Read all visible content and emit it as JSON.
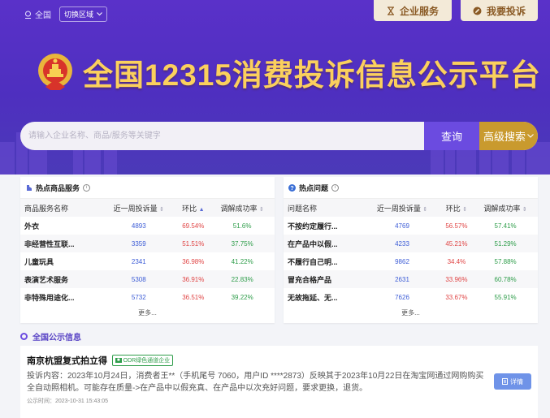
{
  "topbar": {
    "location": "全国",
    "switch_region": "切换区域",
    "enterprise_service": "企业服务",
    "complain": "我要投诉"
  },
  "site_title": "全国12315消费投诉信息公示平台",
  "search": {
    "placeholder": "请输入企业名称、商品/服务等关键字",
    "query_label": "查询",
    "advanced_label": "高级搜索"
  },
  "hot_products": {
    "title": "热点商品服务",
    "columns": [
      "商品服务名称",
      "近一周投诉量",
      "环比",
      "调解成功率"
    ],
    "rows": [
      {
        "name": "外衣",
        "count": "4893",
        "ratio": "69.54%",
        "rate": "51.6%"
      },
      {
        "name": "非经营性互联...",
        "count": "3359",
        "ratio": "51.51%",
        "rate": "37.75%"
      },
      {
        "name": "儿童玩具",
        "count": "2341",
        "ratio": "36.98%",
        "rate": "41.22%"
      },
      {
        "name": "表演艺术服务",
        "count": "5308",
        "ratio": "36.91%",
        "rate": "22.83%"
      },
      {
        "name": "非特殊用途化...",
        "count": "5732",
        "ratio": "36.51%",
        "rate": "39.22%"
      }
    ],
    "more": "更多..."
  },
  "hot_issues": {
    "title": "热点问题",
    "columns": [
      "问题名称",
      "近一周投诉量",
      "环比",
      "调解成功率"
    ],
    "rows": [
      {
        "name": "不按约定履行...",
        "count": "4769",
        "ratio": "56.57%",
        "rate": "57.41%"
      },
      {
        "name": "在产品中以假...",
        "count": "4233",
        "ratio": "45.21%",
        "rate": "51.29%"
      },
      {
        "name": "不履行自己明...",
        "count": "9862",
        "ratio": "34.4%",
        "rate": "57.88%"
      },
      {
        "name": "冒充合格产品",
        "count": "2631",
        "ratio": "33.96%",
        "rate": "60.78%"
      },
      {
        "name": "无故拖延、无...",
        "count": "7626",
        "ratio": "33.67%",
        "rate": "55.91%"
      }
    ],
    "more": "更多..."
  },
  "notices": {
    "title": "全国公示信息",
    "items": [
      {
        "merchant": "南京杭盟复式拍立得",
        "badge": "ODR绿色通道企业",
        "content": "投诉内容：2023年10月24日，消费者王**（手机尾号 7060，用户ID ****2873）反映其于2023年10月22日在淘宝网通过网购购买全自动照相机。可能存在质量->在产品中以假充真、在产品中以次充好问题，要求更换，退货。",
        "time": "公示时间：2023-10-31 15:43:05",
        "detail_label": "详情"
      }
    ]
  },
  "colors": {
    "hero": "#5a31c9",
    "title_gold": "#fbd05d",
    "count_blue": "#3b5bd6",
    "ratio_red": "#e04545",
    "rate_green": "#2e9d4a"
  }
}
